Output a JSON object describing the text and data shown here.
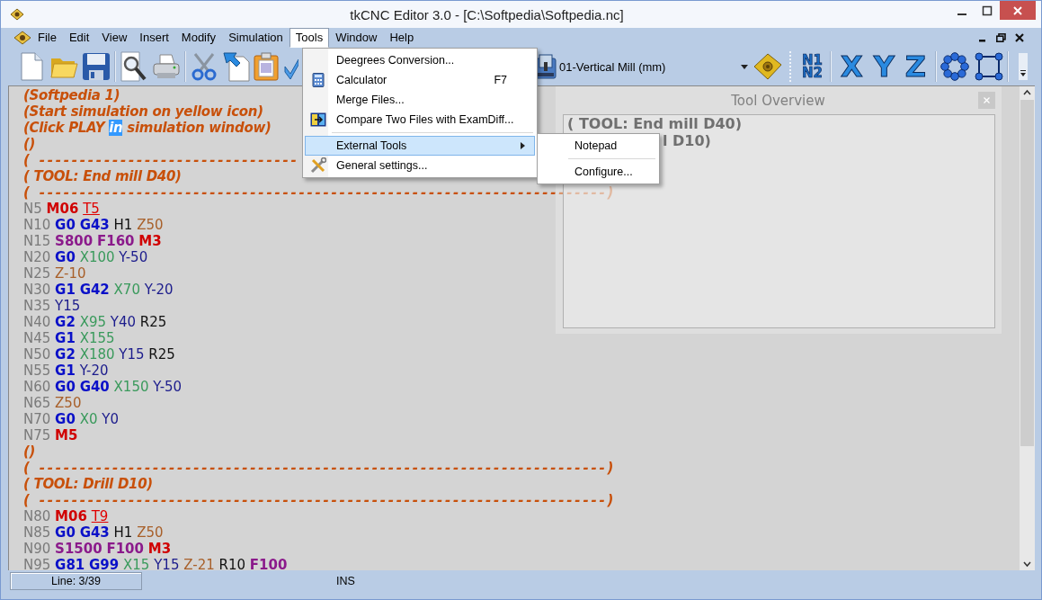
{
  "window": {
    "title": "tkCNC Editor 3.0 - [C:\\Softpedia\\Softpedia.nc]"
  },
  "menu_bar": [
    {
      "label": "File",
      "selected": false
    },
    {
      "label": "Edit",
      "selected": false
    },
    {
      "label": "View",
      "selected": false
    },
    {
      "label": "Insert",
      "selected": false
    },
    {
      "label": "Modify",
      "selected": false
    },
    {
      "label": "Simulation",
      "selected": false
    },
    {
      "label": "Tools",
      "selected": true
    },
    {
      "label": "Window",
      "selected": false
    },
    {
      "label": "Help",
      "selected": false
    }
  ],
  "toolbar": {
    "machine": "01-Vertical Mill (mm)",
    "text_buttons": [
      {
        "kind": "stack",
        "top": "N1",
        "bottom": "N2"
      },
      {
        "kind": "axis",
        "label": "X"
      },
      {
        "kind": "axis",
        "label": "Y"
      },
      {
        "kind": "axis",
        "label": "Z"
      }
    ]
  },
  "editor": {
    "lines": [
      {
        "kind": "comment",
        "tokens": [
          {
            "kind": "comment",
            "text": "(Softpedia 1)"
          }
        ]
      },
      {
        "kind": "comment",
        "tokens": [
          {
            "kind": "comment",
            "text": "(Start simulation on yellow icon)"
          }
        ]
      },
      {
        "kind": "comment",
        "tokens": [
          {
            "kind": "comment",
            "text": "(Click PLAY "
          },
          {
            "kind": "selection",
            "text": "in"
          },
          {
            "kind": "comment",
            "text": " simulation window)"
          }
        ]
      },
      {
        "kind": "comment",
        "tokens": [
          {
            "kind": "comment",
            "text": "()"
          }
        ]
      },
      {
        "kind": "comment",
        "tokens": [
          {
            "kind": "rule",
            "text": "( --------------------------------"
          }
        ]
      },
      {
        "kind": "comment",
        "tokens": [
          {
            "kind": "comment",
            "text": "( TOOL: End mill D40)"
          }
        ]
      },
      {
        "kind": "comment",
        "tokens": [
          {
            "kind": "rule",
            "text": "( ----------------------------------------------------------------------)"
          }
        ]
      },
      {
        "kind": "code",
        "tokens": [
          {
            "kind": "n",
            "text": "N5"
          },
          {
            "kind": "m",
            "text": "M06"
          },
          {
            "kind": "t",
            "text": "T5"
          }
        ]
      },
      {
        "kind": "code",
        "tokens": [
          {
            "kind": "n",
            "text": "N10"
          },
          {
            "kind": "g",
            "text": "G0"
          },
          {
            "kind": "g",
            "text": "G43"
          },
          {
            "kind": "p",
            "text": "H1"
          },
          {
            "kind": "z",
            "text": "Z50"
          }
        ]
      },
      {
        "kind": "code",
        "tokens": [
          {
            "kind": "n",
            "text": "N15"
          },
          {
            "kind": "s",
            "text": "S800"
          },
          {
            "kind": "s",
            "text": "F160"
          },
          {
            "kind": "m",
            "text": "M3"
          }
        ]
      },
      {
        "kind": "code",
        "tokens": [
          {
            "kind": "n",
            "text": "N20"
          },
          {
            "kind": "g",
            "text": "G0"
          },
          {
            "kind": "x",
            "text": "X100"
          },
          {
            "kind": "y",
            "text": "Y-50"
          }
        ]
      },
      {
        "kind": "code",
        "tokens": [
          {
            "kind": "n",
            "text": "N25"
          },
          {
            "kind": "z",
            "text": "Z-10"
          }
        ]
      },
      {
        "kind": "code",
        "tokens": [
          {
            "kind": "n",
            "text": "N30"
          },
          {
            "kind": "g",
            "text": "G1"
          },
          {
            "kind": "g",
            "text": "G42"
          },
          {
            "kind": "x",
            "text": "X70"
          },
          {
            "kind": "y",
            "text": "Y-20"
          }
        ]
      },
      {
        "kind": "code",
        "tokens": [
          {
            "kind": "n",
            "text": "N35"
          },
          {
            "kind": "y",
            "text": "Y15"
          }
        ]
      },
      {
        "kind": "code",
        "tokens": [
          {
            "kind": "n",
            "text": "N40"
          },
          {
            "kind": "g",
            "text": "G2"
          },
          {
            "kind": "x",
            "text": "X95"
          },
          {
            "kind": "y",
            "text": "Y40"
          },
          {
            "kind": "p",
            "text": "R25"
          }
        ]
      },
      {
        "kind": "code",
        "tokens": [
          {
            "kind": "n",
            "text": "N45"
          },
          {
            "kind": "g",
            "text": "G1"
          },
          {
            "kind": "x",
            "text": "X155"
          }
        ]
      },
      {
        "kind": "code",
        "tokens": [
          {
            "kind": "n",
            "text": "N50"
          },
          {
            "kind": "g",
            "text": "G2"
          },
          {
            "kind": "x",
            "text": "X180"
          },
          {
            "kind": "y",
            "text": "Y15"
          },
          {
            "kind": "p",
            "text": "R25"
          }
        ]
      },
      {
        "kind": "code",
        "tokens": [
          {
            "kind": "n",
            "text": "N55"
          },
          {
            "kind": "g",
            "text": "G1"
          },
          {
            "kind": "y",
            "text": "Y-20"
          }
        ]
      },
      {
        "kind": "code",
        "tokens": [
          {
            "kind": "n",
            "text": "N60"
          },
          {
            "kind": "g",
            "text": "G0"
          },
          {
            "kind": "g",
            "text": "G40"
          },
          {
            "kind": "x",
            "text": "X150"
          },
          {
            "kind": "y",
            "text": "Y-50"
          }
        ]
      },
      {
        "kind": "code",
        "tokens": [
          {
            "kind": "n",
            "text": "N65"
          },
          {
            "kind": "z",
            "text": "Z50"
          }
        ]
      },
      {
        "kind": "code",
        "tokens": [
          {
            "kind": "n",
            "text": "N70"
          },
          {
            "kind": "g",
            "text": "G0"
          },
          {
            "kind": "x",
            "text": "X0"
          },
          {
            "kind": "y",
            "text": "Y0"
          }
        ]
      },
      {
        "kind": "code",
        "tokens": [
          {
            "kind": "n",
            "text": "N75"
          },
          {
            "kind": "m",
            "text": "M5"
          }
        ]
      },
      {
        "kind": "comment",
        "tokens": [
          {
            "kind": "comment",
            "text": "()"
          }
        ]
      },
      {
        "kind": "comment",
        "tokens": [
          {
            "kind": "rule",
            "text": "( ----------------------------------------------------------------------)"
          }
        ]
      },
      {
        "kind": "comment",
        "tokens": [
          {
            "kind": "comment",
            "text": "( TOOL: Drill D10)"
          }
        ]
      },
      {
        "kind": "comment",
        "tokens": [
          {
            "kind": "rule",
            "text": "( ----------------------------------------------------------------------)"
          }
        ]
      },
      {
        "kind": "code",
        "tokens": [
          {
            "kind": "n",
            "text": "N80"
          },
          {
            "kind": "m",
            "text": "M06"
          },
          {
            "kind": "t",
            "text": "T9"
          }
        ]
      },
      {
        "kind": "code",
        "tokens": [
          {
            "kind": "n",
            "text": "N85"
          },
          {
            "kind": "g",
            "text": "G0"
          },
          {
            "kind": "g",
            "text": "G43"
          },
          {
            "kind": "p",
            "text": "H1"
          },
          {
            "kind": "z",
            "text": "Z50"
          }
        ]
      },
      {
        "kind": "code",
        "tokens": [
          {
            "kind": "n",
            "text": "N90"
          },
          {
            "kind": "s",
            "text": "S1500"
          },
          {
            "kind": "s",
            "text": "F100"
          },
          {
            "kind": "m",
            "text": "M3"
          }
        ]
      },
      {
        "kind": "code",
        "tokens": [
          {
            "kind": "n",
            "text": "N95"
          },
          {
            "kind": "g",
            "text": "G81"
          },
          {
            "kind": "g",
            "text": "G99"
          },
          {
            "kind": "x",
            "text": "X15"
          },
          {
            "kind": "y",
            "text": "Y15"
          },
          {
            "kind": "z",
            "text": "Z-21"
          },
          {
            "kind": "p",
            "text": "R10"
          },
          {
            "kind": "s",
            "text": "F100"
          }
        ]
      }
    ]
  },
  "tool_overview": {
    "title": "Tool Overview",
    "lines": [
      "( TOOL: End mill D40)",
      "l D10)"
    ]
  },
  "tools_menu": {
    "items": [
      {
        "kind": "plain",
        "label": "Deegrees Conversion...",
        "selected": false
      },
      {
        "kind": "calculator",
        "label": "Calculator",
        "shortcut": "F7",
        "selected": false
      },
      {
        "kind": "plain",
        "label": "Merge Files...",
        "selected": false
      },
      {
        "kind": "compare",
        "label": "Compare Two Files with ExamDiff...",
        "selected": false
      },
      {
        "kind": "separator"
      },
      {
        "kind": "submenu",
        "label": "External Tools",
        "selected": true,
        "expanded": true,
        "items": [
          {
            "kind": "plain",
            "label": "Notepad"
          },
          {
            "kind": "separator"
          },
          {
            "kind": "plain",
            "label": "Configure..."
          }
        ]
      },
      {
        "kind": "settings",
        "label": "General settings...",
        "selected": false
      }
    ]
  },
  "status_bar": {
    "position": "Line: 3/39",
    "mode": "INS"
  }
}
